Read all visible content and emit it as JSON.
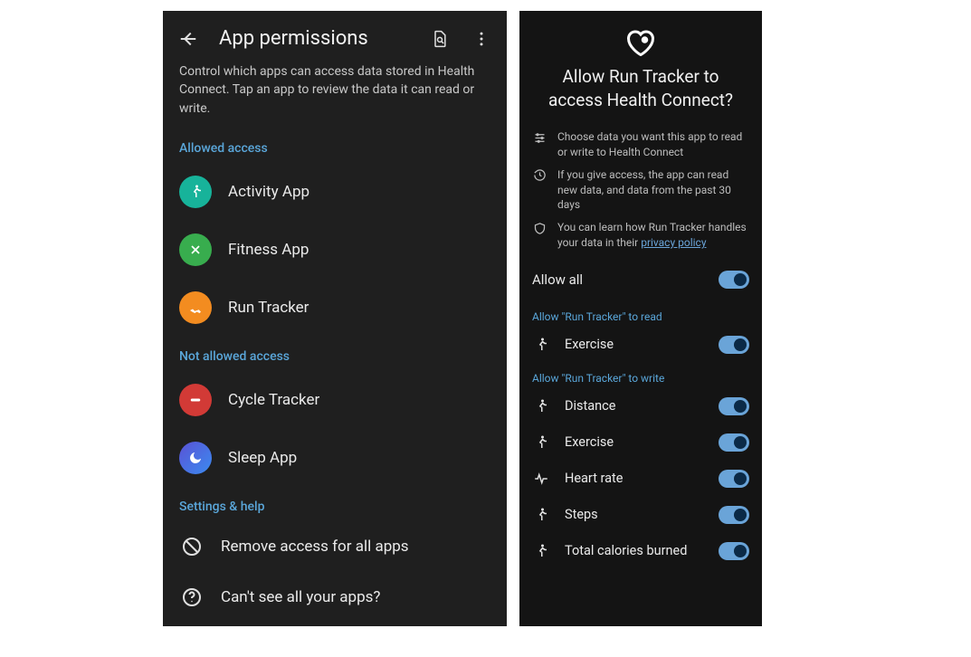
{
  "left": {
    "title": "App permissions",
    "description": "Control which apps can access data stored in Health Connect. Tap an app to review the data it can read or write.",
    "sections": {
      "allowed_label": "Allowed access",
      "not_allowed_label": "Not allowed access",
      "settings_label": "Settings & help"
    },
    "apps_allowed": [
      {
        "label": "Activity App",
        "icon": "activity",
        "color": "#17b39a"
      },
      {
        "label": "Fitness App",
        "icon": "fitness",
        "color": "#38ad4e"
      },
      {
        "label": "Run Tracker",
        "icon": "run",
        "color": "#f38c20"
      }
    ],
    "apps_not_allowed": [
      {
        "label": "Cycle Tracker",
        "icon": "cycle",
        "color": "#d23a36"
      },
      {
        "label": "Sleep App",
        "icon": "sleep",
        "color": "#5a52d5"
      }
    ],
    "settings_items": [
      {
        "label": "Remove access for all apps",
        "icon": "block"
      },
      {
        "label": "Can't see all your apps?",
        "icon": "help"
      }
    ]
  },
  "right": {
    "title": "Allow Run Tracker to access Health Connect?",
    "info": [
      "Choose data you want this app to read or write to Health Connect",
      "If you give access, the app can read new data, and data from the past 30 days",
      "You can learn how Run Tracker handles your data in their "
    ],
    "privacy_link": "privacy policy",
    "allow_all_label": "Allow all",
    "read_label": "Allow \"Run Tracker\" to read",
    "write_label": "Allow \"Run Tracker\" to write",
    "read_perms": [
      {
        "label": "Exercise"
      }
    ],
    "write_perms": [
      {
        "label": "Distance"
      },
      {
        "label": "Exercise"
      },
      {
        "label": "Heart rate"
      },
      {
        "label": "Steps"
      },
      {
        "label": "Total calories burned"
      }
    ]
  }
}
